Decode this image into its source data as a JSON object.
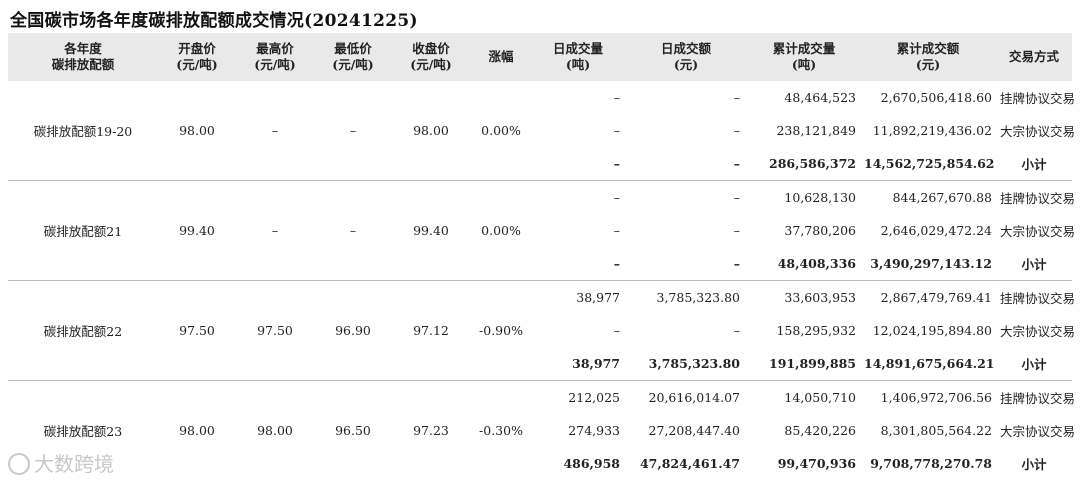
{
  "title": "全国碳市场各年度碳排放配额成交情况(20241225)",
  "headers": [
    [
      "各年度",
      "碳排放配额"
    ],
    [
      "开盘价",
      "(元/吨)"
    ],
    [
      "最高价",
      "(元/吨)"
    ],
    [
      "最低价",
      "(元/吨)"
    ],
    [
      "收盘价",
      "(元/吨)"
    ],
    [
      "涨幅",
      ""
    ],
    [
      "日成交量",
      "(吨)"
    ],
    [
      "日成交额",
      "(元)"
    ],
    [
      "累计成交量",
      "(吨)"
    ],
    [
      "累计成交额",
      "(元)"
    ],
    [
      "交易方式",
      ""
    ]
  ],
  "groups": [
    {
      "name": "碳排放配额19-20",
      "open": "98.00",
      "high": "–",
      "low": "–",
      "close": "98.00",
      "change": "0.00%",
      "rows": [
        {
          "vol": "–",
          "amt": "–",
          "cum_vol": "48,464,523",
          "cum_amt": "2,670,506,418.60",
          "mode": "挂牌协议交易"
        },
        {
          "vol": "–",
          "amt": "–",
          "cum_vol": "238,121,849",
          "cum_amt": "11,892,219,436.02",
          "mode": "大宗协议交易"
        },
        {
          "vol": "–",
          "amt": "–",
          "cum_vol": "286,586,372",
          "cum_amt": "14,562,725,854.62",
          "mode": "小计"
        }
      ]
    },
    {
      "name": "碳排放配额21",
      "open": "99.40",
      "high": "–",
      "low": "–",
      "close": "99.40",
      "change": "0.00%",
      "rows": [
        {
          "vol": "–",
          "amt": "–",
          "cum_vol": "10,628,130",
          "cum_amt": "844,267,670.88",
          "mode": "挂牌协议交易"
        },
        {
          "vol": "–",
          "amt": "–",
          "cum_vol": "37,780,206",
          "cum_amt": "2,646,029,472.24",
          "mode": "大宗协议交易"
        },
        {
          "vol": "–",
          "amt": "–",
          "cum_vol": "48,408,336",
          "cum_amt": "3,490,297,143.12",
          "mode": "小计"
        }
      ]
    },
    {
      "name": "碳排放配额22",
      "open": "97.50",
      "high": "97.50",
      "low": "96.90",
      "close": "97.12",
      "change": "-0.90%",
      "rows": [
        {
          "vol": "38,977",
          "amt": "3,785,323.80",
          "cum_vol": "33,603,953",
          "cum_amt": "2,867,479,769.41",
          "mode": "挂牌协议交易"
        },
        {
          "vol": "–",
          "amt": "–",
          "cum_vol": "158,295,932",
          "cum_amt": "12,024,195,894.80",
          "mode": "大宗协议交易"
        },
        {
          "vol": "38,977",
          "amt": "3,785,323.80",
          "cum_vol": "191,899,885",
          "cum_amt": "14,891,675,664.21",
          "mode": "小计"
        }
      ]
    },
    {
      "name": "碳排放配额23",
      "open": "98.00",
      "high": "98.00",
      "low": "96.50",
      "close": "97.23",
      "change": "-0.30%",
      "rows": [
        {
          "vol": "212,025",
          "amt": "20,616,014.07",
          "cum_vol": "14,050,710",
          "cum_amt": "1,406,972,706.56",
          "mode": "挂牌协议交易"
        },
        {
          "vol": "274,933",
          "amt": "27,208,447.40",
          "cum_vol": "85,420,226",
          "cum_amt": "8,301,805,564.22",
          "mode": "大宗协议交易"
        },
        {
          "vol": "486,958",
          "amt": "47,824,461.47",
          "cum_vol": "99,470,936",
          "cum_amt": "9,708,778,270.78",
          "mode": "小计"
        }
      ]
    }
  ],
  "watermark": "大数跨境",
  "colors": {
    "header_bg": "#e9e9e9",
    "rule": "#bfbfbf",
    "watermark": "#c8c8c8"
  }
}
